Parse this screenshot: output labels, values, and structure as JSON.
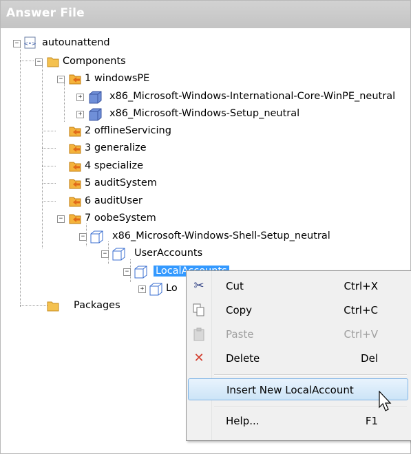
{
  "panel": {
    "title": "Answer File"
  },
  "tree": {
    "root": "autounattend",
    "components": "Components",
    "pass1": "1 windowsPE",
    "pass1_child1": "x86_Microsoft-Windows-International-Core-WinPE_neutral",
    "pass1_child2": "x86_Microsoft-Windows-Setup_neutral",
    "pass2": "2 offlineServicing",
    "pass3": "3 generalize",
    "pass4": "4 specialize",
    "pass5": "5 auditSystem",
    "pass6": "6 auditUser",
    "pass7": "7 oobeSystem",
    "shell_setup": "x86_Microsoft-Windows-Shell-Setup_neutral",
    "user_accounts": "UserAccounts",
    "local_accounts": "LocalAccounts",
    "local_account_child": "Lo",
    "packages": "Packages"
  },
  "context_menu": {
    "items": [
      {
        "label": "Cut",
        "shortcut": "Ctrl+X",
        "icon": "scissors-icon"
      },
      {
        "label": "Copy",
        "shortcut": "Ctrl+C",
        "icon": "copy-icon"
      },
      {
        "label": "Paste",
        "shortcut": "Ctrl+V",
        "icon": "paste-icon"
      },
      {
        "label": "Delete",
        "shortcut": "Del",
        "icon": "delete-icon"
      },
      {
        "label": "Insert New LocalAccount",
        "shortcut": ""
      },
      {
        "label": "Help...",
        "shortcut": "F1"
      }
    ]
  },
  "colors": {
    "selection": "#3399ff",
    "menu_hover": "#cce4f7",
    "folder": "#f2b13c",
    "component": "#6f8fd8"
  }
}
